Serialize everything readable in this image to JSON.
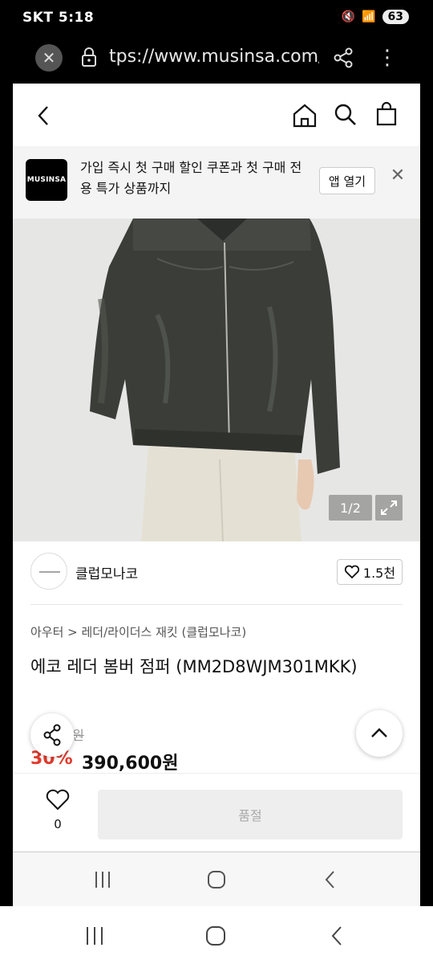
{
  "status_bar": {
    "left_text": "SKT 5:18",
    "battery": "63"
  },
  "browser": {
    "url": "tps://www.musinsa.com/p"
  },
  "banner": {
    "logo_text": "MUSINSA",
    "message": "가입 즉시 첫 구매 할인 쿠폰과 첫 구매 전용 특가 상품까지",
    "open_label": "앱 열기",
    "close_label": "✕"
  },
  "gallery": {
    "counter": "1/2"
  },
  "brand": {
    "name": "클럽모나코",
    "likes": "1.5천"
  },
  "product": {
    "breadcrumb": "아우터 > 레더/라이더스 재킷 (클럽모나코)",
    "title": "에코 레더 봄버 점퍼 (MM2D8WJM301MKK)",
    "original_price_visible": "0원",
    "discount": "30%",
    "price": "390,600원"
  },
  "purchase": {
    "wish_count": "0",
    "soldout_label": "품절"
  },
  "colors": {
    "discount_red": "#e03a2e",
    "background": "#ffffff"
  }
}
